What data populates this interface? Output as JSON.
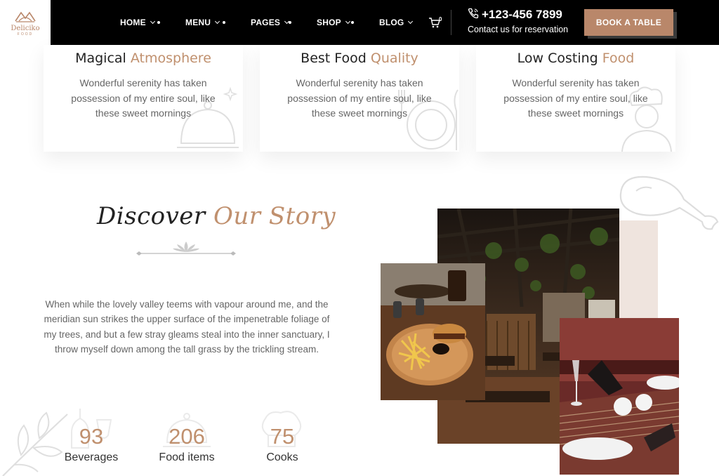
{
  "brand": {
    "name": "Deliciko",
    "tagline": "FOOD"
  },
  "nav": {
    "items": [
      {
        "label": "HOME",
        "has_dot": true
      },
      {
        "label": "MENU",
        "has_dot": true
      },
      {
        "label": "PAGES",
        "has_dot": true
      },
      {
        "label": "SHOP",
        "has_dot": true
      },
      {
        "label": "BLOG",
        "has_dot": false
      }
    ],
    "cart_count": "0",
    "phone": "+123-456 7899",
    "phone_caption": "Contact us for reservation",
    "cta": "BOOK A TABLE"
  },
  "features": [
    {
      "title_plain": "Magical",
      "title_accent": "Atmosphere",
      "text": "Wonderful serenity has taken possession of my entire soul, like these sweet mornings",
      "icon": "cloche-icon"
    },
    {
      "title_plain": "Best Food",
      "title_accent": "Quality",
      "text": "Wonderful serenity has taken possession of my entire soul, like these sweet mornings",
      "icon": "plate-icon"
    },
    {
      "title_plain": "Low Costing",
      "title_accent": "Food",
      "text": "Wonderful serenity has taken possession of my entire soul, like these sweet mornings",
      "icon": "chef-icon"
    }
  ],
  "story": {
    "title_plain": "Discover",
    "title_accent": "Our Story",
    "text": "When while the lovely valley teems with vapour around me, and the meridian sun strikes the upper surface of the impenetrable foliage of my trees, and but a few stray gleams steal into the inner sanctuary, I throw myself down among the tall grass by the trickling stream."
  },
  "stats": [
    {
      "value": "93",
      "label": "Beverages"
    },
    {
      "value": "206",
      "label": "Food items"
    },
    {
      "value": "75",
      "label": "Cooks"
    }
  ],
  "colors": {
    "accent": "#c0906e",
    "button": "#b9876a",
    "nav_bg": "#000000",
    "beige": "#efe4de"
  },
  "images": {
    "burger": "burger-and-fries-photo",
    "interior": "restaurant-interior-photo",
    "table": "table-setting-photo"
  }
}
